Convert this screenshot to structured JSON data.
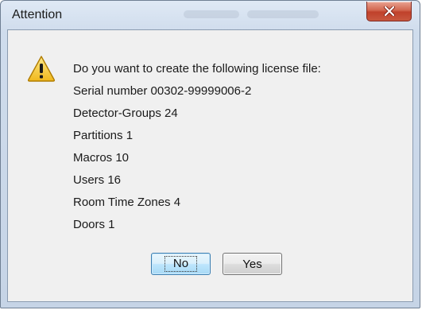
{
  "window": {
    "title": "Attention"
  },
  "icon": "warning-icon",
  "message": {
    "lines": [
      "Do you want to create the following license file:",
      "Serial number 00302-99999006-2",
      "Detector-Groups 24",
      "Partitions 1",
      "Macros 10",
      "Users 16",
      "Room Time Zones 4",
      "Doors 1"
    ]
  },
  "buttons": {
    "no_label": "No",
    "yes_label": "Yes",
    "default": "No"
  },
  "colors": {
    "close_button": "#c8583f",
    "warning_fill": "#f4c430",
    "default_button_border": "#3c7fb1",
    "client_background": "#f0f0f0"
  }
}
